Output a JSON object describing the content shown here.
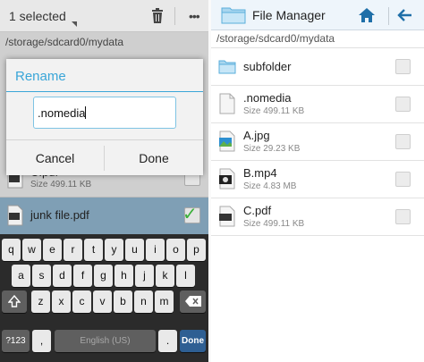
{
  "left": {
    "selection_label": "1 selected",
    "path": "/storage/sdcard0/mydata",
    "rows": [
      {
        "name": "C.pdf",
        "size": "Size 499.11 KB"
      },
      {
        "name": "junk file.pdf",
        "size": ""
      }
    ],
    "dialog": {
      "title": "Rename",
      "input_value": ".nomedia",
      "cancel_label": "Cancel",
      "done_label": "Done"
    },
    "keyboard": {
      "row1": [
        "q",
        "w",
        "e",
        "r",
        "t",
        "y",
        "u",
        "i",
        "o",
        "p"
      ],
      "row2": [
        "a",
        "s",
        "d",
        "f",
        "g",
        "h",
        "j",
        "k",
        "l"
      ],
      "row3": [
        "z",
        "x",
        "c",
        "v",
        "b",
        "n",
        "m"
      ],
      "sym_label": "?123",
      "comma": ",",
      "space_label": "English (US)",
      "period": ".",
      "done_label": "Done"
    }
  },
  "right": {
    "title": "File Manager",
    "path": "/storage/sdcard0/mydata",
    "items": [
      {
        "name": "subfolder",
        "size": "",
        "icon": "folder-icon"
      },
      {
        "name": ".nomedia",
        "size": "Size 499.11 KB",
        "icon": "file-icon"
      },
      {
        "name": "A.jpg",
        "size": "Size 29.23 KB",
        "icon": "image-file-icon"
      },
      {
        "name": "B.mp4",
        "size": "Size 4.83 MB",
        "icon": "video-file-icon"
      },
      {
        "name": "C.pdf",
        "size": "Size 499.11 KB",
        "icon": "pdf-file-icon"
      }
    ]
  },
  "colors": {
    "accent": "#3aa6d8",
    "done_key": "#2e5f93",
    "check": "#3ab03a"
  }
}
